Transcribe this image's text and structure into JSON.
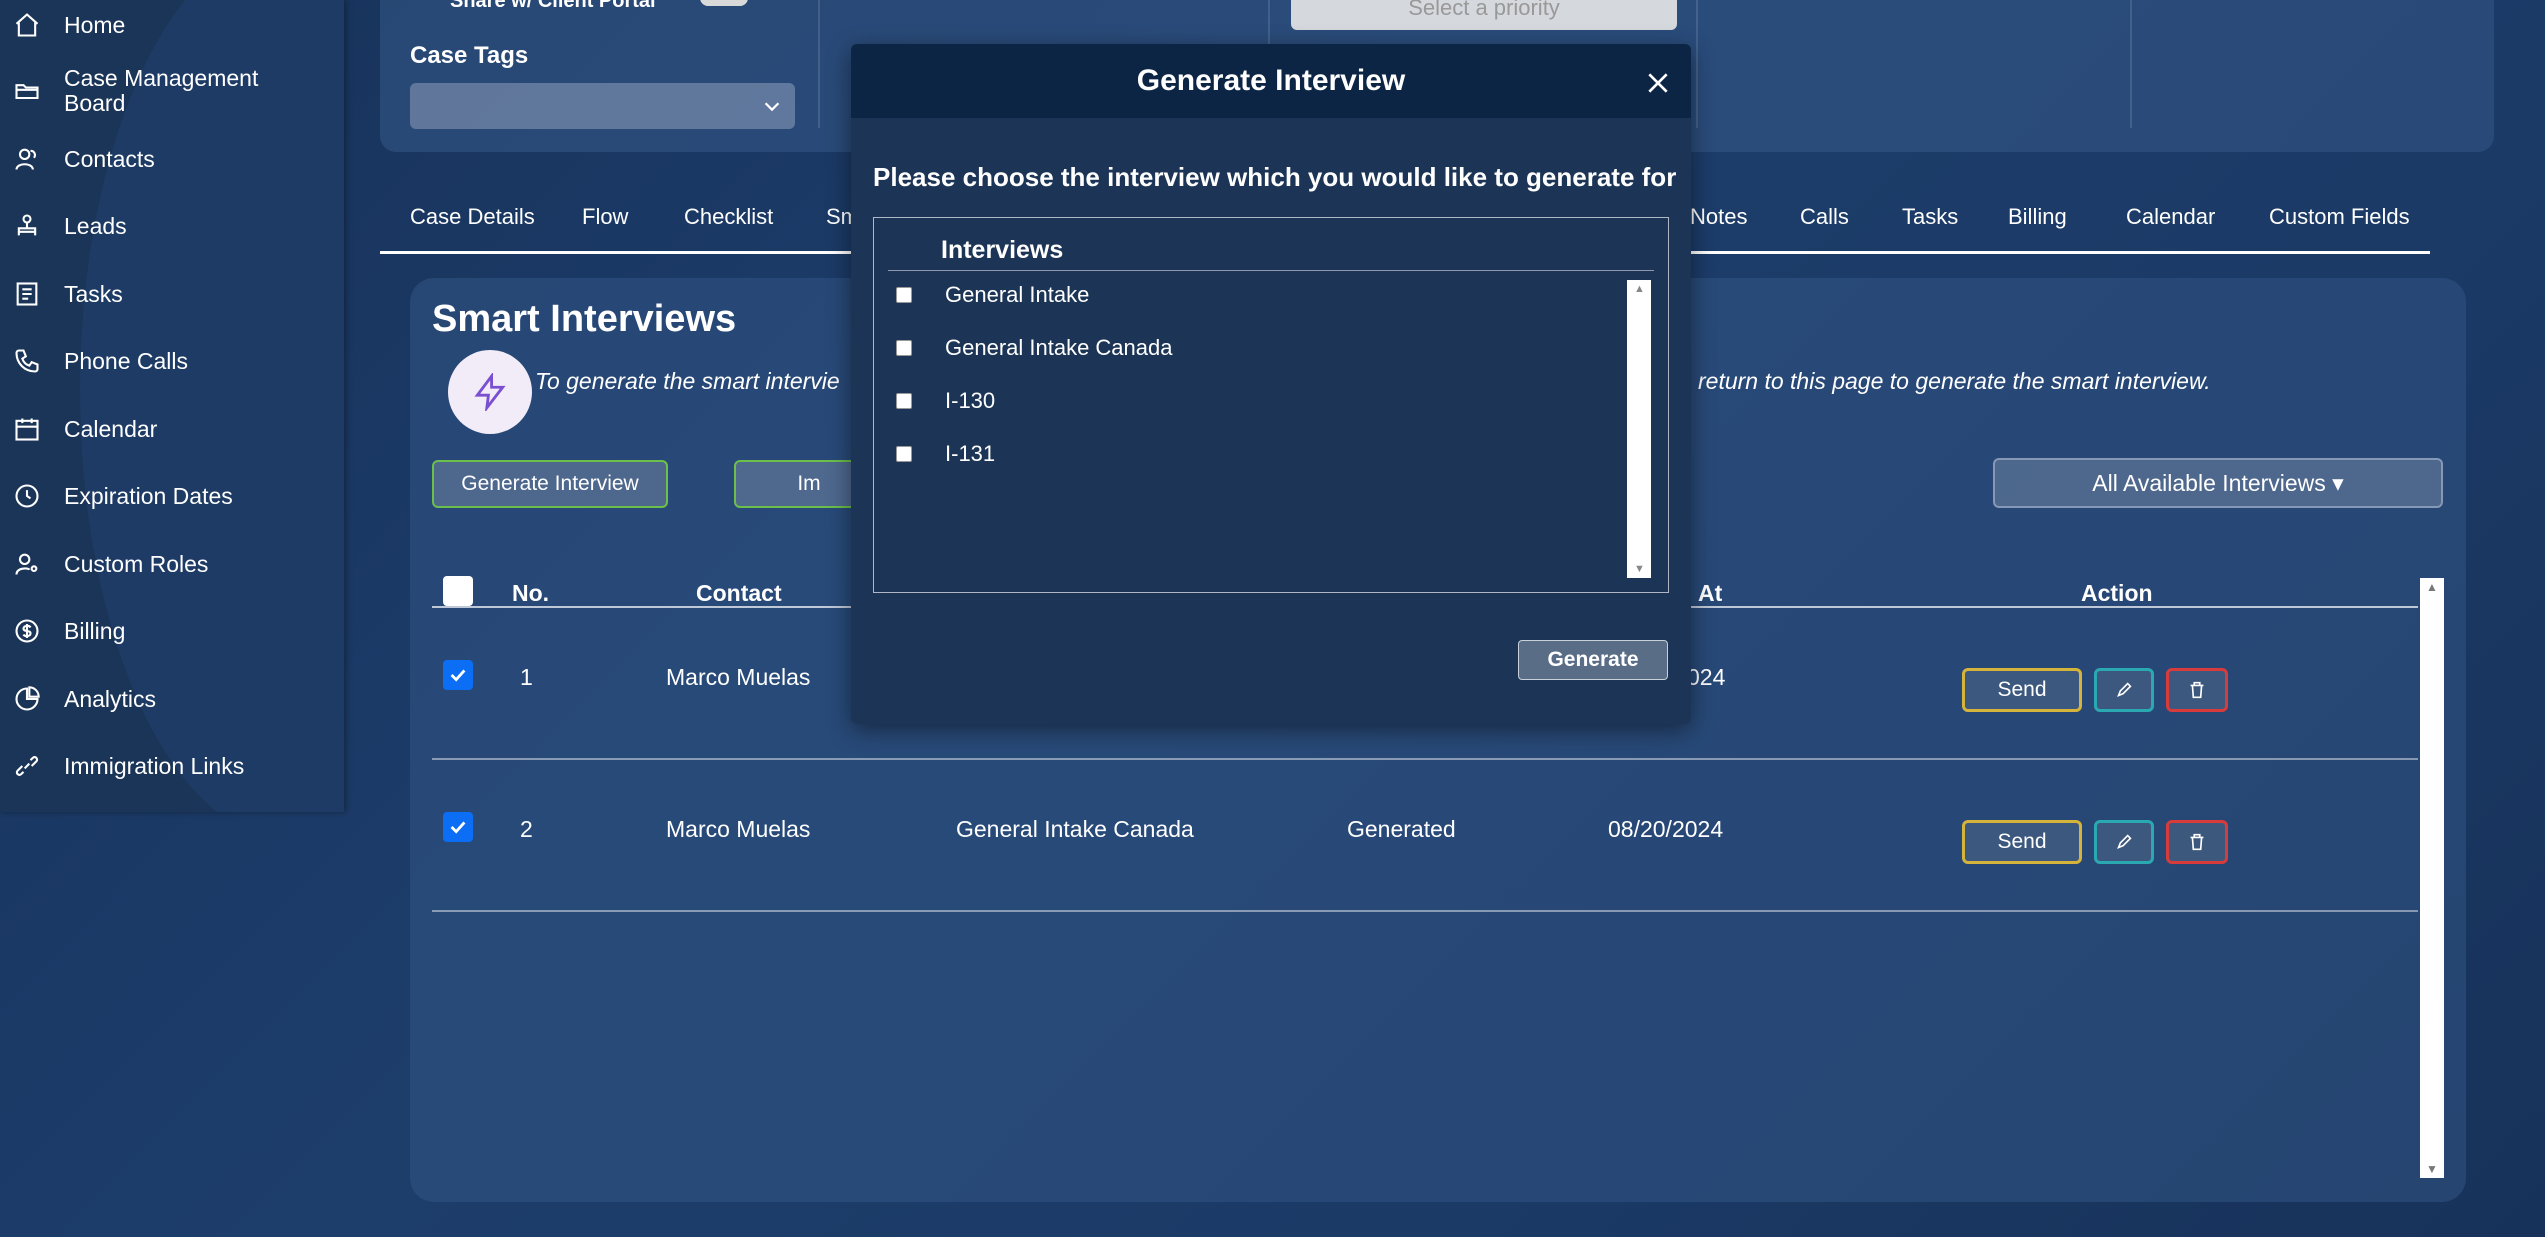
{
  "sidebar": {
    "items": [
      {
        "label": "Home",
        "icon": "home-icon"
      },
      {
        "label": "Case Management Board",
        "icon": "folder-icon"
      },
      {
        "label": "Contacts",
        "icon": "contacts-icon"
      },
      {
        "label": "Leads",
        "icon": "leads-icon"
      },
      {
        "label": "Tasks",
        "icon": "tasks-icon"
      },
      {
        "label": "Phone Calls",
        "icon": "phone-icon"
      },
      {
        "label": "Calendar",
        "icon": "calendar-icon"
      },
      {
        "label": "Expiration Dates",
        "icon": "clock-icon"
      },
      {
        "label": "Custom Roles",
        "icon": "user-gear-icon"
      },
      {
        "label": "Billing",
        "icon": "dollar-icon"
      },
      {
        "label": "Analytics",
        "icon": "pie-chart-icon"
      },
      {
        "label": "Immigration Links",
        "icon": "link-icon"
      }
    ]
  },
  "top_card": {
    "portal_text": "Share w/ Client Portal",
    "case_tags_label": "Case Tags",
    "priority_placeholder": "Select a priority"
  },
  "tabs": [
    {
      "label": "Case Details"
    },
    {
      "label": "Flow"
    },
    {
      "label": "Checklist"
    },
    {
      "label": "Sm"
    },
    {
      "label": "Notes"
    },
    {
      "label": "Calls"
    },
    {
      "label": "Tasks"
    },
    {
      "label": "Billing"
    },
    {
      "label": "Calendar"
    },
    {
      "label": "Custom Fields"
    }
  ],
  "panel": {
    "title": "Smart Interviews",
    "hint_left": "To generate the smart intervie",
    "hint_right": "return to this page to generate the smart interview.",
    "generate_button": "Generate Interview",
    "second_button": "Im",
    "filter_label": "All Available Interviews ▾"
  },
  "table": {
    "headers": {
      "no": "No.",
      "contact": "Contact",
      "at": "At",
      "action": "Action"
    },
    "rows": [
      {
        "no": "1",
        "contact": "Marco Muelas",
        "interview": "",
        "status": "",
        "date": "024",
        "checked": true
      },
      {
        "no": "2",
        "contact": "Marco Muelas",
        "interview": "General Intake Canada",
        "status": "Generated",
        "date": "08/20/2024",
        "checked": true
      }
    ],
    "send_label": "Send"
  },
  "modal": {
    "title": "Generate Interview",
    "prompt": "Please choose the interview which you would like to generate for",
    "list_header": "Interviews",
    "options": [
      {
        "label": "General Intake",
        "checked": false
      },
      {
        "label": "General Intake Canada",
        "checked": false
      },
      {
        "label": "I-130",
        "checked": false
      },
      {
        "label": "I-131",
        "checked": false
      }
    ],
    "generate_label": "Generate"
  },
  "colors": {
    "background": "#1b3a66",
    "sidebar": "#1a3557",
    "modal_header": "#0d2545",
    "send_border": "#d6b33a",
    "edit_border": "#2aa9b2",
    "delete_border": "#d83b3b",
    "checkbox_checked": "#0b6ef5",
    "generate_interview_border": "#6bbf4a"
  }
}
